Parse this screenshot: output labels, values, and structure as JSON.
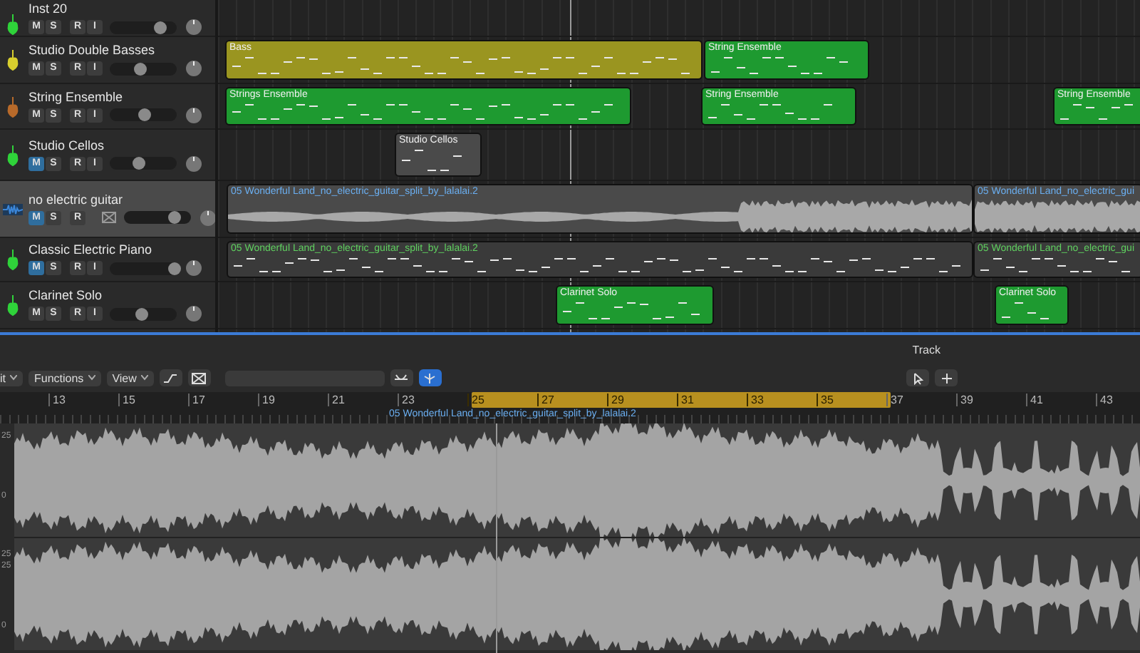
{
  "tracks": [
    {
      "name": "Inst 20",
      "kind": "midi",
      "color": "#2fd33a",
      "selected": false,
      "level": 0.75,
      "buttons": [
        {
          "label": "M",
          "on": false
        },
        {
          "label": "S",
          "on": false
        },
        {
          "label": "R",
          "on": false
        },
        {
          "label": "I",
          "on": false
        }
      ]
    },
    {
      "name": "Studio Double Basses",
      "kind": "midi",
      "color": "#d8cf2e",
      "selected": false,
      "level": 0.45,
      "buttons": [
        {
          "label": "M",
          "on": false
        },
        {
          "label": "S",
          "on": false
        },
        {
          "label": "R",
          "on": false
        },
        {
          "label": "I",
          "on": false
        }
      ],
      "regions": [
        {
          "label": "Bass",
          "color": "#9a9520"
        },
        {
          "label": "String Ensemble",
          "color": "#1e9a30"
        }
      ]
    },
    {
      "name": "String Ensemble",
      "kind": "midi",
      "color": "#b86a2a",
      "selected": false,
      "level": 0.5,
      "buttons": [
        {
          "label": "M",
          "on": false
        },
        {
          "label": "S",
          "on": false
        },
        {
          "label": "R",
          "on": false
        },
        {
          "label": "I",
          "on": false
        }
      ],
      "regions": [
        {
          "label": "Strings Ensemble",
          "color": "#1e9a30"
        },
        {
          "label": "String Ensemble",
          "color": "#1e9a30"
        },
        {
          "label": "String Ensemble",
          "color": "#1e9a30"
        }
      ]
    },
    {
      "name": "Studio Cellos",
      "kind": "midi",
      "color": "#2fd33a",
      "selected": false,
      "level": 0.42,
      "buttons": [
        {
          "label": "M",
          "on": true
        },
        {
          "label": "S",
          "on": false
        },
        {
          "label": "R",
          "on": false
        },
        {
          "label": "I",
          "on": false
        }
      ],
      "regions": [
        {
          "label": "Studio Cellos",
          "color": "#4a4a4a"
        }
      ]
    },
    {
      "name": "no electric guitar",
      "kind": "audio",
      "color": "#3b86d9",
      "selected": true,
      "level": 0.75,
      "buttons": [
        {
          "label": "M",
          "on": true
        },
        {
          "label": "S",
          "on": false
        },
        {
          "label": "R",
          "on": false
        }
      ],
      "regions": [
        {
          "label": "05 Wonderful Land_no_electric_guitar_split_by_lalalai.2",
          "color": "#4a4a4a"
        },
        {
          "label": "05 Wonderful Land_no_electric_gui",
          "color": "#4a4a4a"
        }
      ]
    },
    {
      "name": "Classic Electric Piano",
      "kind": "midi",
      "color": "#2fd33a",
      "selected": false,
      "level": 0.95,
      "buttons": [
        {
          "label": "M",
          "on": true
        },
        {
          "label": "S",
          "on": false
        },
        {
          "label": "R",
          "on": false
        },
        {
          "label": "I",
          "on": false
        }
      ],
      "regions": [
        {
          "label": "05 Wonderful Land_no_electric_guitar_split_by_lalalai.2",
          "color": "#3a3a3a"
        },
        {
          "label": "05 Wonderful Land_no_electric_gui",
          "color": "#3a3a3a"
        }
      ]
    },
    {
      "name": "Clarinet Solo",
      "kind": "midi",
      "color": "#2fd33a",
      "selected": false,
      "level": 0.47,
      "buttons": [
        {
          "label": "M",
          "on": false
        },
        {
          "label": "S",
          "on": false
        },
        {
          "label": "R",
          "on": false
        },
        {
          "label": "I",
          "on": false
        }
      ],
      "regions": [
        {
          "label": "Clarinet Solo",
          "color": "#1e9a30"
        },
        {
          "label": "Clarinet Solo",
          "color": "#1e9a30"
        }
      ]
    }
  ],
  "editor": {
    "title": "Track",
    "menus": [
      "it",
      "Functions",
      "View"
    ],
    "flex_on": true,
    "cycle": true,
    "ruler": [
      "13",
      "15",
      "17",
      "19",
      "21",
      "23",
      "25",
      "27",
      "29",
      "31",
      "33",
      "35",
      "37",
      "39",
      "41",
      "43"
    ],
    "region_label": "05 Wonderful Land_no_electric_guitar_split_by_lalalai.2",
    "amplitude_labels": [
      "25",
      "0",
      "25",
      "25",
      "0"
    ]
  }
}
